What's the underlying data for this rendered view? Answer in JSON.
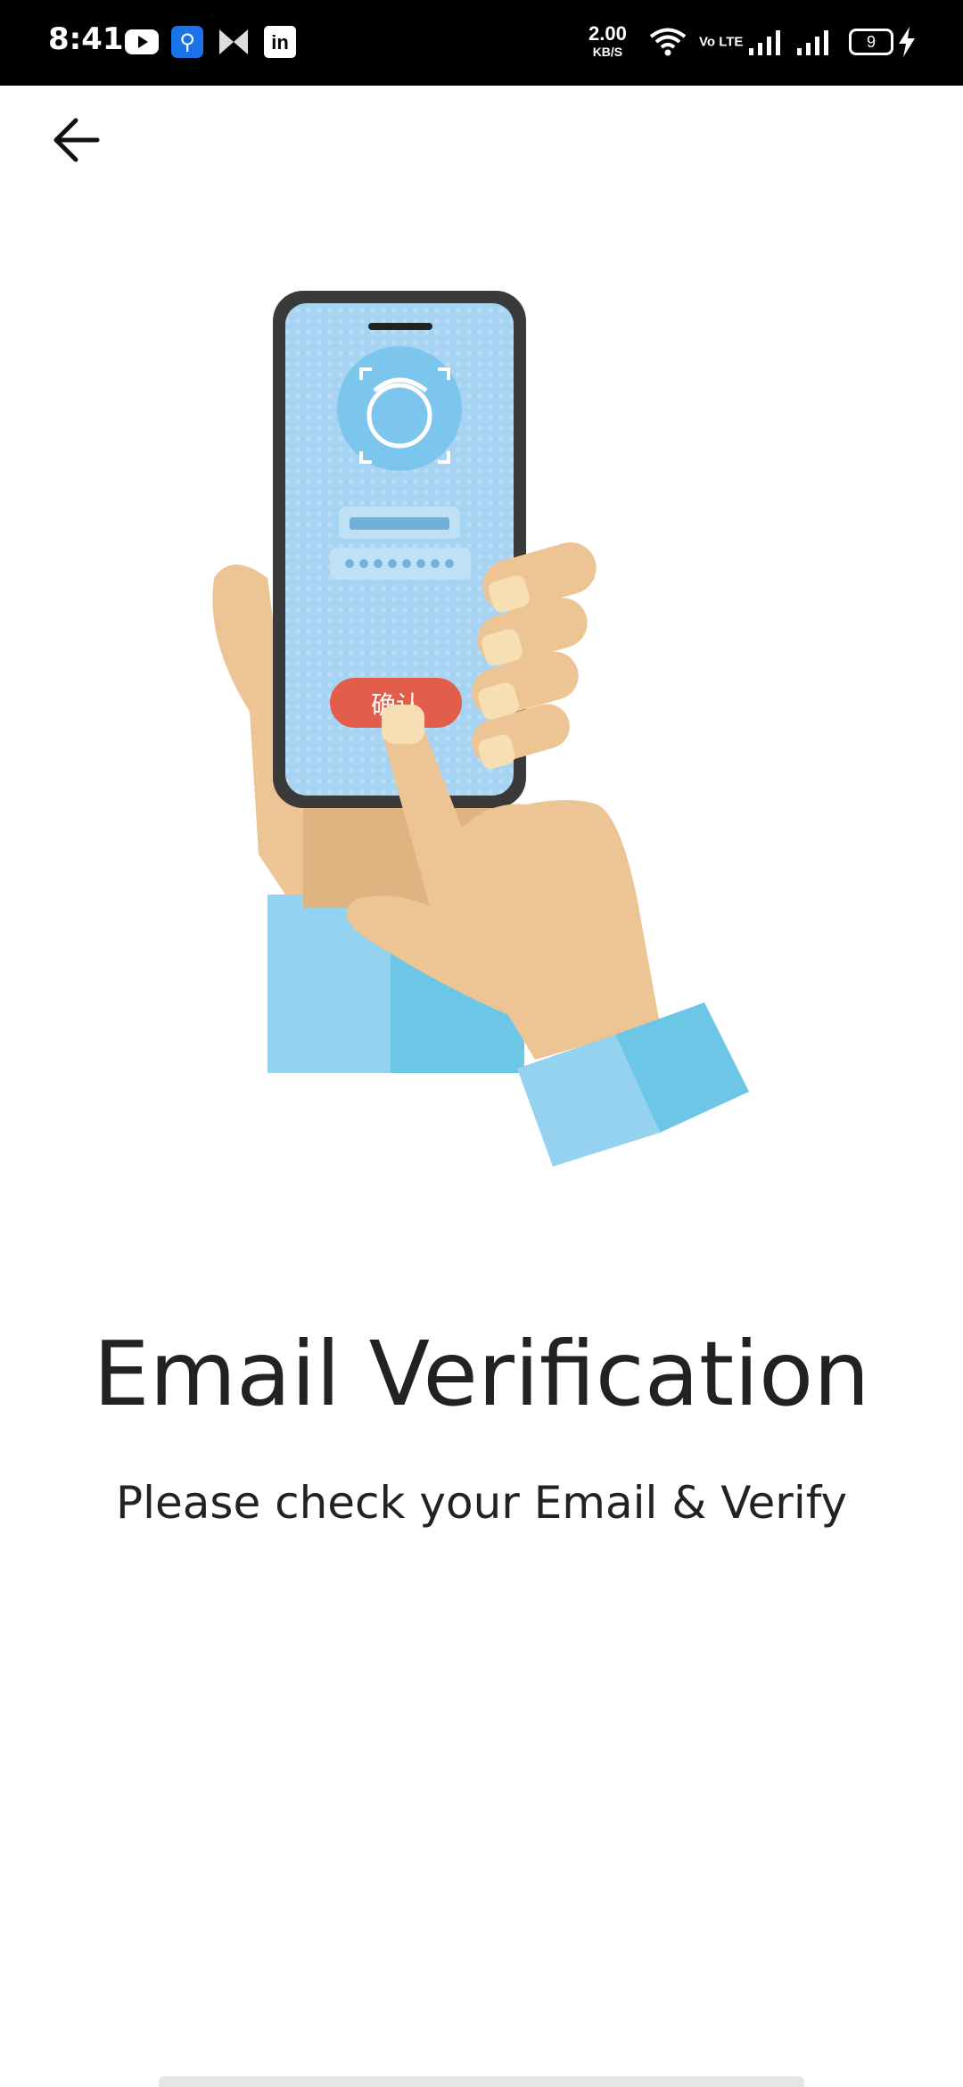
{
  "status_bar": {
    "time": "8:41",
    "net_speed_value": "2.00",
    "net_speed_unit": "KB/S",
    "volte_label": "Vo LTE",
    "battery_level": "9",
    "icons": [
      "youtube-icon",
      "usb-icon",
      "mx-icon",
      "linkedin-icon",
      "wifi-icon",
      "volte-icon",
      "signal-icon",
      "signal-icon",
      "battery-icon",
      "charging-icon"
    ]
  },
  "header": {
    "back_icon": "arrow-left-icon"
  },
  "illustration": {
    "button_label": "确认",
    "colors": {
      "screen": "#a7d3f2",
      "button": "#e25d4a",
      "skin": "#edc594",
      "sleeve": "#95d2f0",
      "sleeve_dark": "#6cc7e6",
      "phone_frame": "#3a3a3a"
    }
  },
  "main": {
    "title": "Email Verification",
    "subtitle": "Please check your Email & Verify"
  }
}
